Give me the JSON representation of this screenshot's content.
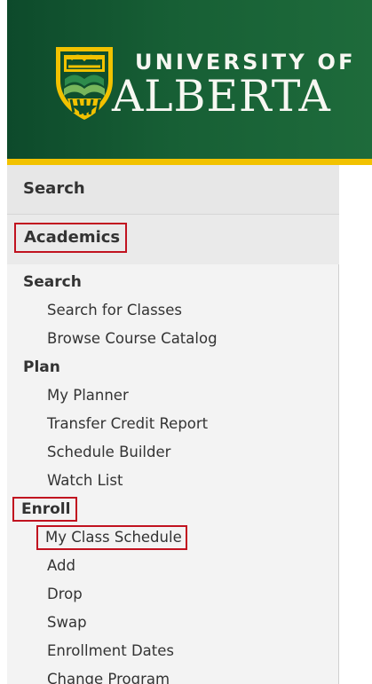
{
  "header": {
    "university_line": "UNIVERSITY OF",
    "name_line": "ALBERTA"
  },
  "sidebar": {
    "top_section": "Search",
    "section_title": "Academics",
    "groups": [
      {
        "title": "Search",
        "items": [
          {
            "label": "Search for Classes"
          },
          {
            "label": "Browse Course Catalog"
          }
        ]
      },
      {
        "title": "Plan",
        "items": [
          {
            "label": "My Planner"
          },
          {
            "label": "Transfer Credit Report"
          },
          {
            "label": "Schedule Builder"
          },
          {
            "label": "Watch List"
          }
        ]
      },
      {
        "title": "Enroll",
        "items": [
          {
            "label": "My Class Schedule"
          },
          {
            "label": "Add"
          },
          {
            "label": "Drop"
          },
          {
            "label": "Swap"
          },
          {
            "label": "Enrollment Dates"
          },
          {
            "label": "Change Program"
          }
        ]
      }
    ]
  },
  "colors": {
    "brand_green": "#175f35",
    "brand_gold": "#f2c200",
    "highlight_red": "#c1121f"
  },
  "icons": {
    "logo": "university-crest-icon"
  }
}
